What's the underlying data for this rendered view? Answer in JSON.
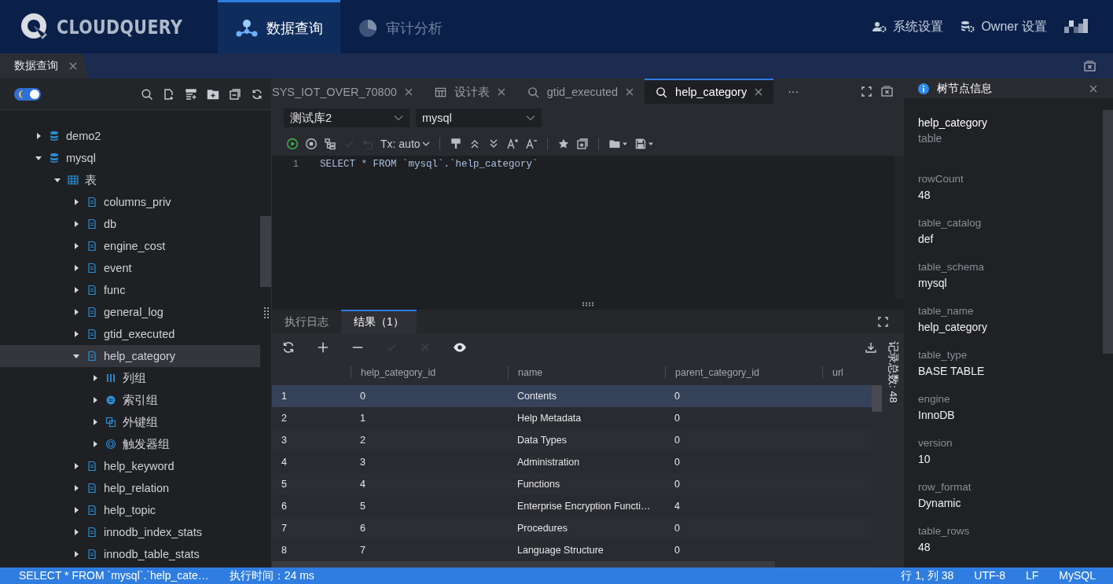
{
  "header": {
    "logo": "CLOUDQUERY",
    "nav": [
      {
        "label": "数据查询",
        "kind": "network",
        "selected": true
      },
      {
        "label": "审计分析",
        "kind": "pie",
        "selected": false
      }
    ],
    "actions": [
      {
        "label": "系统设置",
        "kind": "user-gear"
      },
      {
        "label": "Owner 设置",
        "kind": "db-gear"
      }
    ]
  },
  "page_tabs": [
    {
      "label": "数据查询",
      "selected": true
    }
  ],
  "sidebar": {
    "theme_toggle": {
      "on": true
    },
    "tree": [
      {
        "label": "demo2",
        "kind": "database",
        "expanded": false,
        "selected": false
      },
      {
        "label": "mysql",
        "kind": "database",
        "expanded": true,
        "selected": false,
        "children": [
          {
            "label": "表",
            "kind": "tables",
            "expanded": true,
            "selected": false,
            "children": [
              {
                "label": "columns_priv",
                "kind": "table",
                "expanded": false,
                "selected": false
              },
              {
                "label": "db",
                "kind": "table",
                "expanded": false,
                "selected": false
              },
              {
                "label": "engine_cost",
                "kind": "table",
                "expanded": false,
                "selected": false
              },
              {
                "label": "event",
                "kind": "table",
                "expanded": false,
                "selected": false
              },
              {
                "label": "func",
                "kind": "table",
                "expanded": false,
                "selected": false
              },
              {
                "label": "general_log",
                "kind": "table",
                "expanded": false,
                "selected": false
              },
              {
                "label": "gtid_executed",
                "kind": "table",
                "expanded": false,
                "selected": false
              },
              {
                "label": "help_category",
                "kind": "table",
                "expanded": true,
                "selected": true,
                "children": [
                  {
                    "label": "列组",
                    "kind": "columns",
                    "expanded": false,
                    "selected": false
                  },
                  {
                    "label": "索引组",
                    "kind": "indexes",
                    "expanded": false,
                    "selected": false
                  },
                  {
                    "label": "外键组",
                    "kind": "foreign-keys",
                    "expanded": false,
                    "selected": false
                  },
                  {
                    "label": "触发器组",
                    "kind": "triggers",
                    "expanded": false,
                    "selected": false
                  }
                ]
              },
              {
                "label": "help_keyword",
                "kind": "table",
                "expanded": false,
                "selected": false
              },
              {
                "label": "help_relation",
                "kind": "table",
                "expanded": false,
                "selected": false
              },
              {
                "label": "help_topic",
                "kind": "table",
                "expanded": false,
                "selected": false
              },
              {
                "label": "innodb_index_stats",
                "kind": "table",
                "expanded": false,
                "selected": false
              },
              {
                "label": "innodb_table_stats",
                "kind": "table",
                "expanded": false,
                "selected": false
              }
            ]
          }
        ]
      }
    ]
  },
  "editor": {
    "tabs": [
      {
        "label": "SYS_IOT_OVER_70800",
        "kind": "plain",
        "selected": false
      },
      {
        "label": "设计表",
        "kind": "design",
        "selected": false
      },
      {
        "label": "gtid_executed",
        "kind": "query",
        "selected": false
      },
      {
        "label": "help_category",
        "kind": "query",
        "selected": true
      }
    ],
    "more": "···",
    "connection": "测试库2",
    "database": "mysql",
    "toolbar": [
      [
        {
          "kind": "run",
          "disabled": false
        },
        {
          "kind": "stop",
          "disabled": false
        },
        {
          "kind": "plan",
          "disabled": false
        },
        {
          "kind": "commit",
          "disabled": true
        },
        {
          "kind": "rollback",
          "disabled": true
        },
        {
          "kind": "tx",
          "label": "Tx: auto",
          "disabled": false
        }
      ],
      [
        {
          "kind": "format",
          "disabled": false
        },
        {
          "kind": "up",
          "disabled": false
        },
        {
          "kind": "down",
          "disabled": false
        },
        {
          "kind": "font-up",
          "disabled": false
        },
        {
          "kind": "font-down",
          "disabled": false
        }
      ],
      [
        {
          "kind": "star",
          "disabled": false
        },
        {
          "kind": "favorites",
          "disabled": false
        }
      ],
      [
        {
          "kind": "folder",
          "disabled": false
        },
        {
          "kind": "save",
          "disabled": false
        }
      ]
    ],
    "lines": [
      {
        "number": "1",
        "code": "SELECT * FROM `mysql`.`help_category`"
      }
    ]
  },
  "results": {
    "tabs": [
      {
        "label": "执行日志",
        "selected": false
      },
      {
        "label": "结果（1）",
        "selected": true
      }
    ],
    "toolbar": [
      {
        "kind": "refresh",
        "disabled": false
      },
      {
        "kind": "add",
        "disabled": false
      },
      {
        "kind": "remove",
        "disabled": false
      },
      {
        "kind": "confirm",
        "disabled": true
      },
      {
        "kind": "cancel",
        "disabled": true
      },
      {
        "kind": "view",
        "disabled": false
      }
    ],
    "record_count": "记录总数: 48",
    "table": {
      "columns": [
        "",
        "help_category_id",
        "name",
        "parent_category_id",
        "url"
      ],
      "rows": [
        {
          "cells": [
            "1",
            "0",
            "Contents",
            "0",
            ""
          ],
          "selected": true
        },
        {
          "cells": [
            "2",
            "1",
            "Help Metadata",
            "0",
            ""
          ],
          "selected": false
        },
        {
          "cells": [
            "3",
            "2",
            "Data Types",
            "0",
            ""
          ],
          "selected": false
        },
        {
          "cells": [
            "4",
            "3",
            "Administration",
            "0",
            ""
          ],
          "selected": false
        },
        {
          "cells": [
            "5",
            "4",
            "Functions",
            "0",
            ""
          ],
          "selected": false
        },
        {
          "cells": [
            "6",
            "5",
            "Enterprise Encryption Functi…",
            "4",
            ""
          ],
          "selected": false
        },
        {
          "cells": [
            "7",
            "6",
            "Procedures",
            "0",
            ""
          ],
          "selected": false
        },
        {
          "cells": [
            "8",
            "7",
            "Language Structure",
            "0",
            ""
          ],
          "selected": false
        }
      ]
    }
  },
  "info_panel": {
    "title": "树节点信息",
    "name": "help_category",
    "type": "table",
    "fields": [
      {
        "key": "rowCount",
        "value": "48"
      },
      {
        "key": "table_catalog",
        "value": "def"
      },
      {
        "key": "table_schema",
        "value": "mysql"
      },
      {
        "key": "table_name",
        "value": "help_category"
      },
      {
        "key": "table_type",
        "value": "BASE TABLE"
      },
      {
        "key": "engine",
        "value": "InnoDB"
      },
      {
        "key": "version",
        "value": "10"
      },
      {
        "key": "row_format",
        "value": "Dynamic"
      },
      {
        "key": "table_rows",
        "value": "48"
      }
    ]
  },
  "status_bar": {
    "left": [
      "SELECT * FROM `mysql`.`help_cate…",
      "执行时间：24 ms"
    ],
    "right": [
      "行 1, 列 38",
      "UTF-8",
      "LF",
      "MySQL"
    ]
  }
}
